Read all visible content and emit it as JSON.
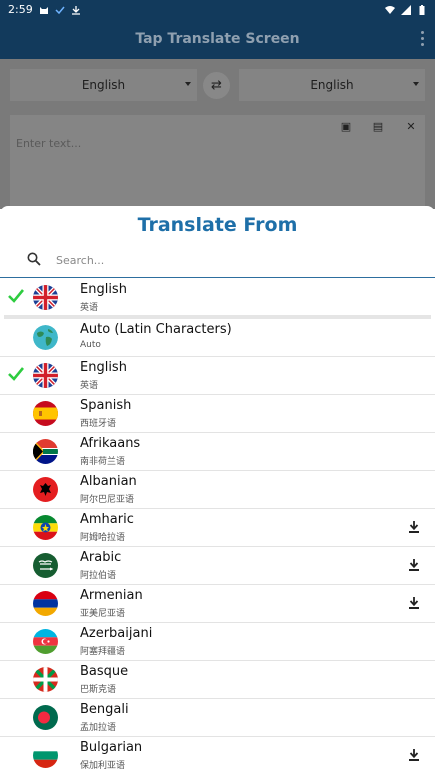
{
  "status_bar": {
    "time": "2:59"
  },
  "app_bar": {
    "title": "Tap Translate Screen"
  },
  "background": {
    "source_language": "English",
    "target_language": "English",
    "input_placeholder": "Enter text..."
  },
  "sheet": {
    "title": "Translate From",
    "search_placeholder": "Search...",
    "selected": {
      "name": "English",
      "native": "英语",
      "flag": "uk-flag-icon"
    },
    "languages": [
      {
        "name": "Auto (Latin Characters)",
        "native": "Auto",
        "flag": "globe-icon",
        "checked": false,
        "download": false
      },
      {
        "name": "English",
        "native": "英语",
        "flag": "uk-flag-icon",
        "checked": true,
        "download": false
      },
      {
        "name": "Spanish",
        "native": "西班牙语",
        "flag": "spain-flag-icon",
        "checked": false,
        "download": false
      },
      {
        "name": "Afrikaans",
        "native": "南非荷兰语",
        "flag": "south-africa-flag-icon",
        "checked": false,
        "download": false
      },
      {
        "name": "Albanian",
        "native": "阿尔巴尼亚语",
        "flag": "albania-flag-icon",
        "checked": false,
        "download": false
      },
      {
        "name": "Amharic",
        "native": "阿姆哈拉语",
        "flag": "ethiopia-flag-icon",
        "checked": false,
        "download": true
      },
      {
        "name": "Arabic",
        "native": "阿拉伯语",
        "flag": "saudi-flag-icon",
        "checked": false,
        "download": true
      },
      {
        "name": "Armenian",
        "native": "亚美尼亚语",
        "flag": "armenia-flag-icon",
        "checked": false,
        "download": true
      },
      {
        "name": "Azerbaijani",
        "native": "阿塞拜疆语",
        "flag": "azerbaijan-flag-icon",
        "checked": false,
        "download": false
      },
      {
        "name": "Basque",
        "native": "巴斯克语",
        "flag": "basque-flag-icon",
        "checked": false,
        "download": false
      },
      {
        "name": "Bengali",
        "native": "孟加拉语",
        "flag": "bangladesh-flag-icon",
        "checked": false,
        "download": false
      },
      {
        "name": "Bulgarian",
        "native": "保加利亚语",
        "flag": "bulgaria-flag-icon",
        "checked": false,
        "download": true
      }
    ]
  },
  "colors": {
    "accent": "#1e6fa8",
    "check": "#2ecc40",
    "appbar": "#123a5c"
  }
}
